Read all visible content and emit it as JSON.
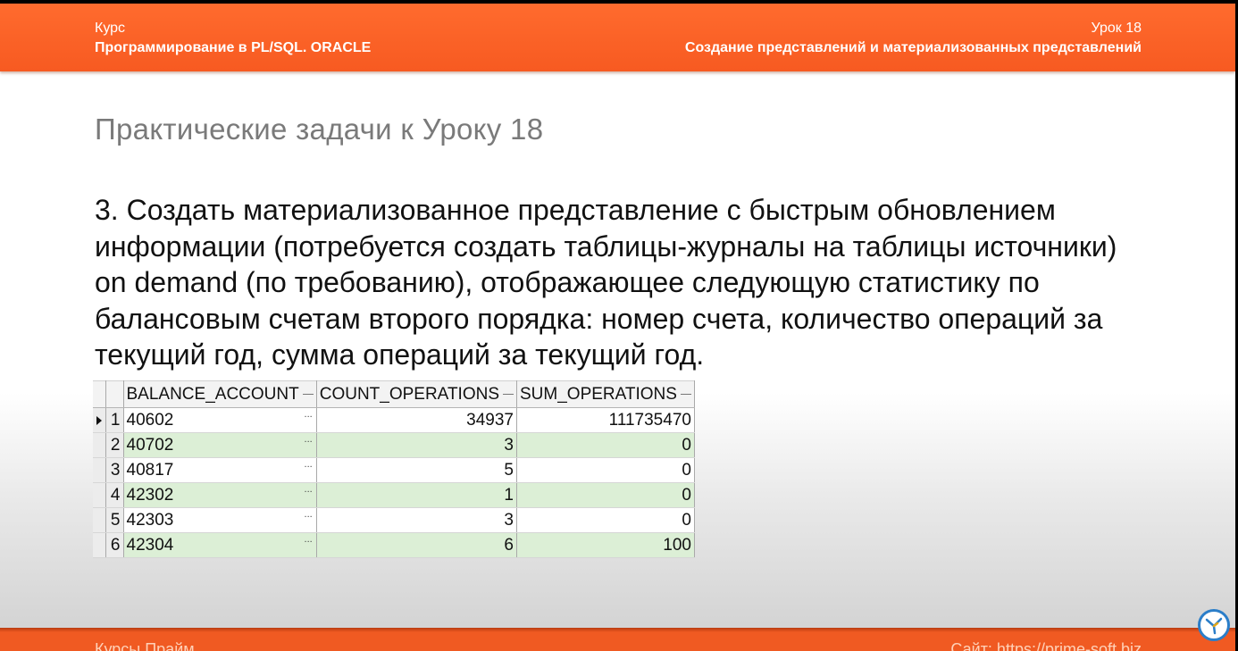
{
  "header": {
    "course_label": "Курс",
    "course_name": "Программирование в PL/SQL. ORACLE",
    "lesson_label": "Урок 18",
    "lesson_name": "Создание представлений и материализованных представлений"
  },
  "slide": {
    "title": "Практические задачи к Уроку 18",
    "task_text": "3. Создать материализованное представление с быстрым обновлением информации (потребуется создать таблицы-журналы на таблицы источники) on demand (по требованию), отображающее следующую статистику по балансовым счетам второго порядка: номер счета, количество операций за текущий год, сумма операций за текущий год."
  },
  "grid": {
    "columns": [
      "BALANCE_ACCOUNT",
      "COUNT_OPERATIONS",
      "SUM_OPERATIONS"
    ],
    "ellipsis": "...",
    "rows": [
      {
        "num": "1",
        "account": "40602",
        "count": "34937",
        "sum": "111735470"
      },
      {
        "num": "2",
        "account": "40702",
        "count": "3",
        "sum": "0"
      },
      {
        "num": "3",
        "account": "40817",
        "count": "5",
        "sum": "0"
      },
      {
        "num": "4",
        "account": "42302",
        "count": "1",
        "sum": "0"
      },
      {
        "num": "5",
        "account": "42303",
        "count": "3",
        "sum": "0"
      },
      {
        "num": "6",
        "account": "42304",
        "count": "6",
        "sum": "100"
      }
    ]
  },
  "footer": {
    "left": "Курсы Прайм",
    "right": "Сайт: https://prime-soft.biz"
  },
  "logo_icon": "prime-bird-icon",
  "colors": {
    "header_orange": "#f75a21",
    "row_green": "#dcefd6",
    "logo_blue": "#2b7ec9"
  }
}
